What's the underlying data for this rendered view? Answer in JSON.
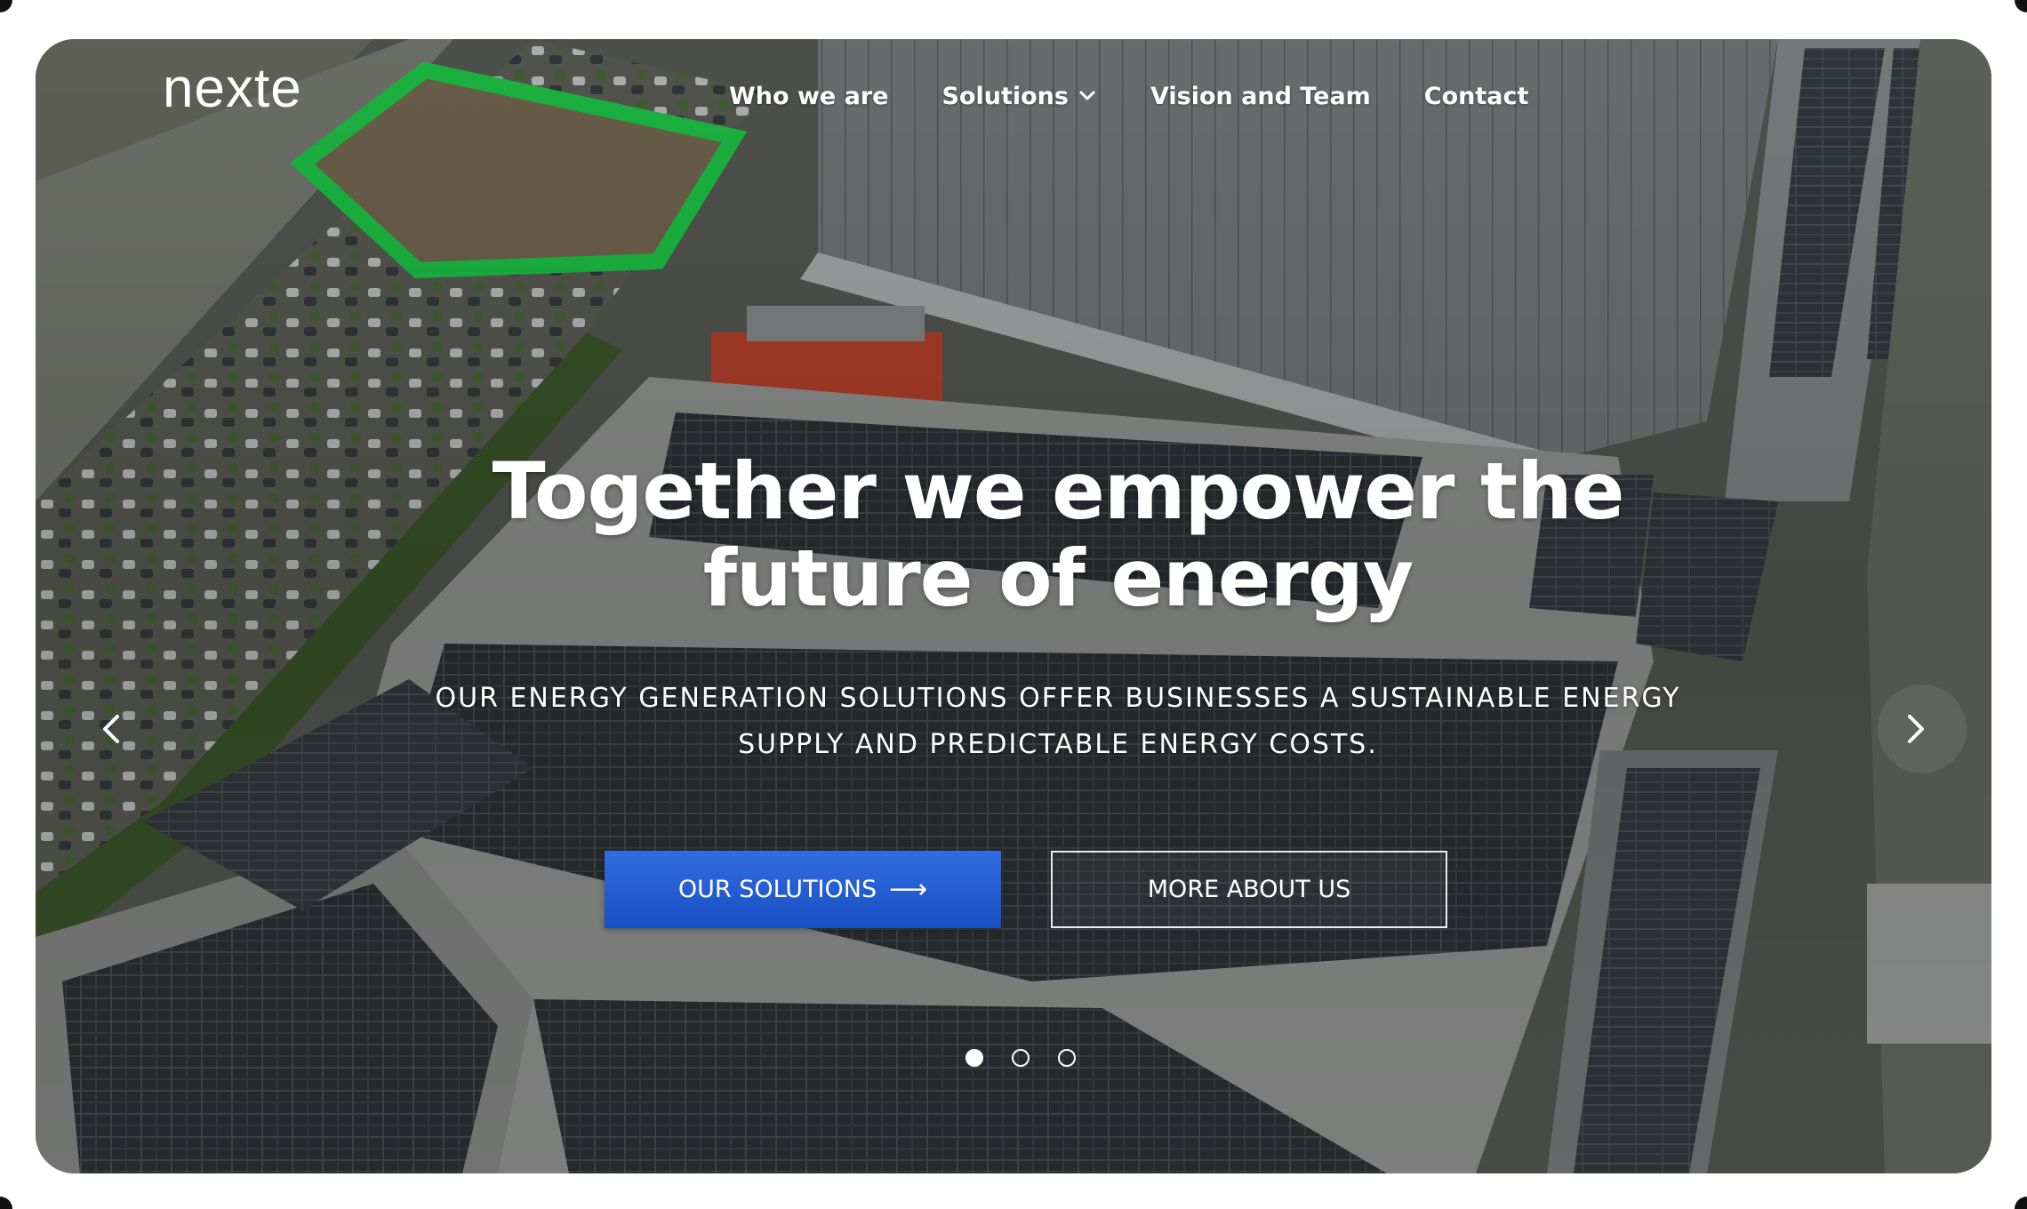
{
  "brand": {
    "logo_text": "nexte"
  },
  "nav": {
    "items": [
      {
        "label": "Who we are"
      },
      {
        "label": "Solutions",
        "has_dropdown": true
      },
      {
        "label": "Vision and Team"
      },
      {
        "label": "Contact"
      }
    ]
  },
  "hero": {
    "headline_line1": "Together we empower the",
    "headline_line2": "future of energy",
    "subline_line1": "OUR ENERGY GENERATION SOLUTIONS OFFER BUSINESSES A SUSTAINABLE ENERGY",
    "subline_line2": "SUPPLY AND PREDICTABLE ENERGY COSTS.",
    "primary_button": "OUR SOLUTIONS",
    "primary_button_arrow": "⟶",
    "secondary_button": "MORE ABOUT US",
    "background_description": ""
  },
  "carousel": {
    "slide_count": 3,
    "active_slide": 1
  },
  "colors": {
    "primary_button": "#2a62d6",
    "text": "#ffffff",
    "logo_accent": "#ffffff"
  },
  "icons": {
    "prev": "chevron-left-icon",
    "next": "chevron-right-icon",
    "dropdown": "chevron-down-icon",
    "arrow": "arrow-right-icon"
  }
}
